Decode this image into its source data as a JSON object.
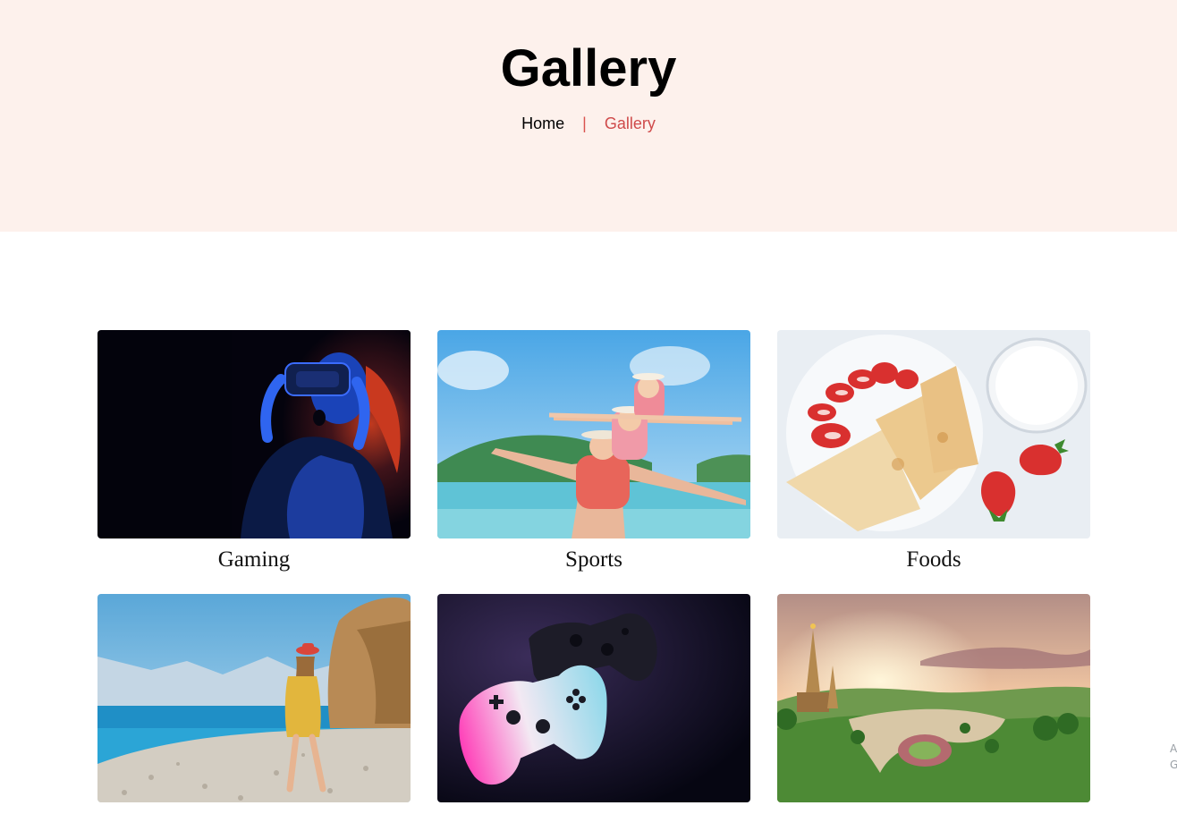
{
  "header": {
    "title": "Gallery",
    "breadcrumb": {
      "home": "Home",
      "separator": "|",
      "current": "Gallery"
    }
  },
  "gallery": {
    "items": [
      {
        "caption": "Gaming",
        "image": "vr-headset-woman-photo"
      },
      {
        "caption": "Sports",
        "image": "family-beach-airplane-photo"
      },
      {
        "caption": "Foods",
        "image": "crepes-strawberries-milk-photo"
      },
      {
        "caption": "",
        "image": "girl-walking-on-beach-photo"
      },
      {
        "caption": "",
        "image": "game-controllers-photo"
      },
      {
        "caption": "",
        "image": "pagoda-sunset-landscape-photo"
      }
    ]
  },
  "overlay": {
    "edge_text": "A G"
  },
  "colors": {
    "hero_bg": "#fdf1ec",
    "accent": "#cf4a4a"
  }
}
